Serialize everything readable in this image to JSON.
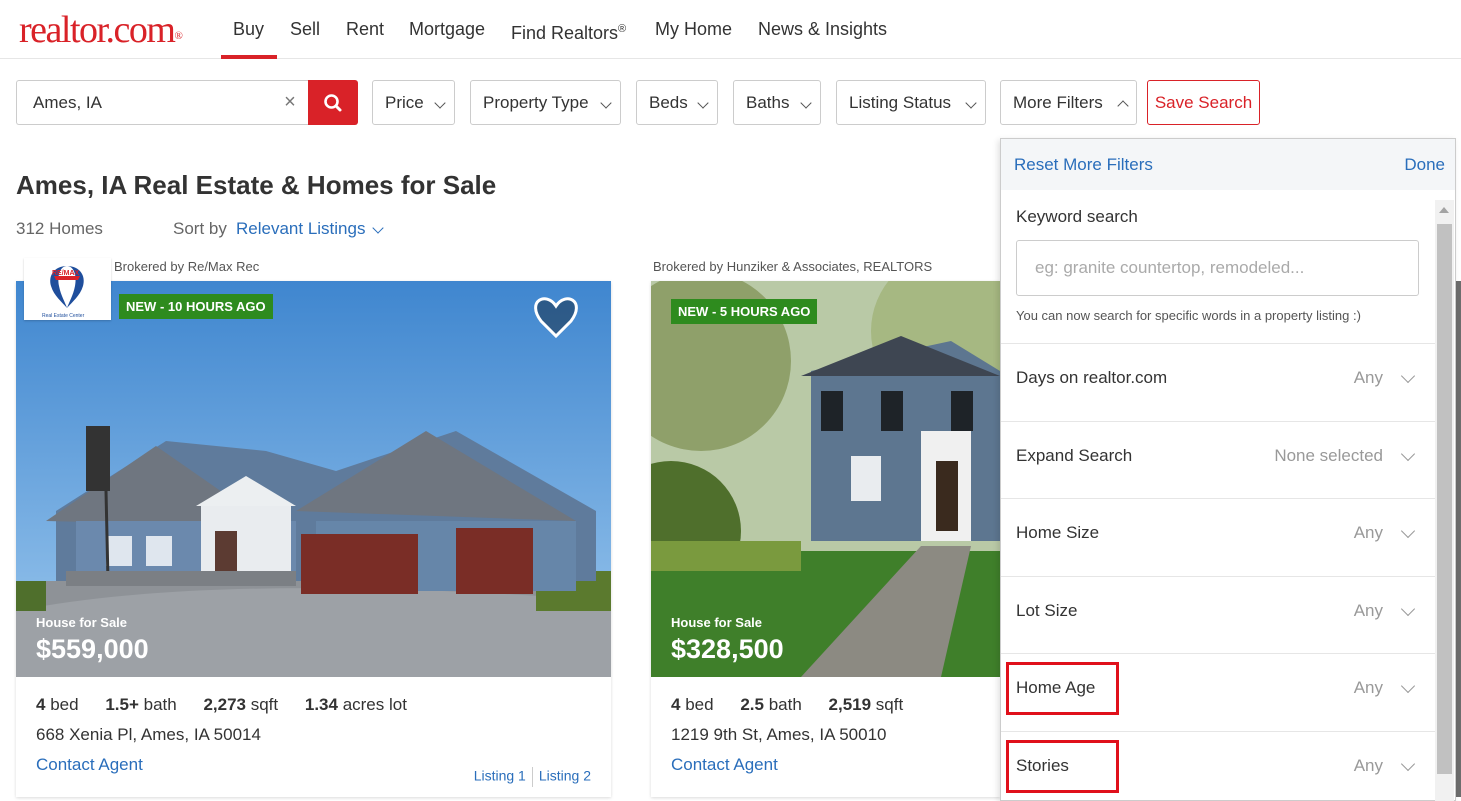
{
  "nav": {
    "logo": "realtor.com",
    "logo_mark": "®",
    "items": [
      "Buy",
      "Sell",
      "Rent",
      "Mortgage",
      "Find Realtors",
      "My Home",
      "News & Insights"
    ],
    "find_realtors_mark": "®"
  },
  "search": {
    "value": "Ames, IA",
    "clear_symbol": "×"
  },
  "filters": {
    "price": "Price",
    "property_type": "Property Type",
    "beds": "Beds",
    "baths": "Baths",
    "listing_status": "Listing Status",
    "more_filters": "More Filters",
    "save_search": "Save Search"
  },
  "results": {
    "title": "Ames, IA Real Estate & Homes for Sale",
    "count": "312 Homes",
    "sort_label": "Sort by",
    "sort_value": "Relevant Listings"
  },
  "listings": [
    {
      "broker": "Brokered by Re/Max Rec",
      "broker_logo": "RE/MAX",
      "broker_logo_sub": "Real Estate Center",
      "badge": "NEW - 10 HOURS AGO",
      "type": "House for Sale",
      "price": "$559,000",
      "beds": "4",
      "beds_unit": "bed",
      "baths": "1.5+",
      "baths_unit": "bath",
      "sqft": "2,273",
      "sqft_unit": "sqft",
      "lot": "1.34",
      "lot_unit": "acres lot",
      "address": "668 Xenia Pl, Ames, IA 50014",
      "contact": "Contact Agent",
      "link1": "Listing 1",
      "link2": "Listing 2"
    },
    {
      "broker": "Brokered by Hunziker & Associates, REALTORS",
      "badge": "NEW - 5 HOURS AGO",
      "type": "House for Sale",
      "price": "$328,500",
      "beds": "4",
      "beds_unit": "bed",
      "baths": "2.5",
      "baths_unit": "bath",
      "sqft": "2,519",
      "sqft_unit": "sqft",
      "address": "1219 9th St, Ames, IA 50010",
      "contact": "Contact Agent"
    }
  ],
  "more_filters_panel": {
    "reset": "Reset More Filters",
    "done": "Done",
    "keyword_label": "Keyword search",
    "keyword_placeholder": "eg: granite countertop, remodeled...",
    "keyword_hint": "You can now search for specific words in a property listing :)",
    "rows": [
      {
        "label": "Days on realtor.com",
        "value": "Any"
      },
      {
        "label": "Expand Search",
        "value": "None selected"
      },
      {
        "label": "Home Size",
        "value": "Any"
      },
      {
        "label": "Lot Size",
        "value": "Any"
      },
      {
        "label": "Home Age",
        "value": "Any"
      },
      {
        "label": "Stories",
        "value": "Any"
      }
    ]
  },
  "colors": {
    "brand_red": "#d92228",
    "link_blue": "#2a6ebb",
    "badge_green": "#2e8b1e",
    "highlight_red": "#e0101b"
  }
}
